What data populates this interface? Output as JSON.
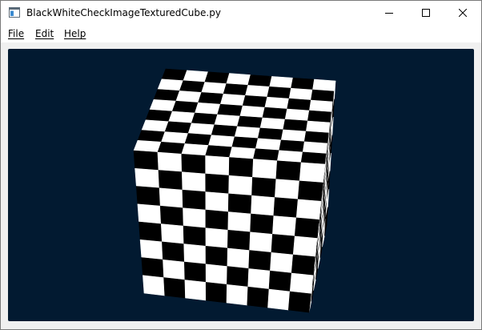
{
  "window": {
    "title": "BlackWhiteCheckImageTexturedCube.py",
    "minimize_symbol": "minimize",
    "maximize_symbol": "maximize",
    "close_symbol": "close"
  },
  "menu": {
    "items": [
      {
        "label": "File",
        "mnemonic": "F"
      },
      {
        "label": "Edit",
        "mnemonic": "E"
      },
      {
        "label": "Help",
        "mnemonic": "H"
      }
    ]
  },
  "viewport": {
    "background_color": "#021a31",
    "object": "textured-cube",
    "texture": "black-white-checkerboard",
    "texture_grid": 8,
    "colors": {
      "light": "#ffffff",
      "dark": "#000000"
    }
  }
}
